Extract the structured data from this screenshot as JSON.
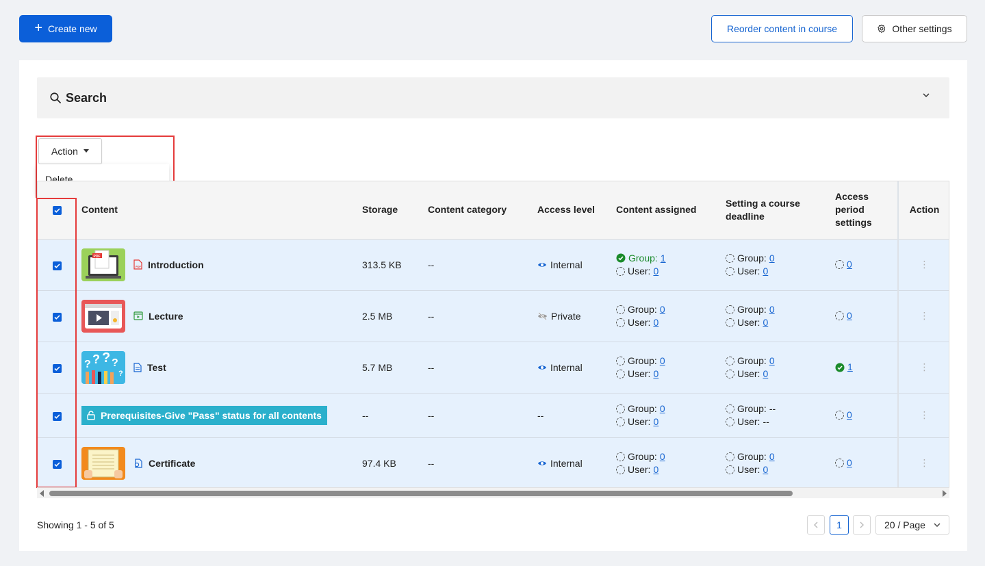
{
  "toolbar": {
    "create_label": "Create new",
    "reorder_label": "Reorder content in course",
    "settings_label": "Other settings"
  },
  "search": {
    "title": "Search"
  },
  "bulk_action": {
    "label": "Action",
    "menu_item": "Delete"
  },
  "table": {
    "headers": {
      "content": "Content",
      "storage": "Storage",
      "category": "Content category",
      "access": "Access level",
      "assigned": "Content assigned",
      "deadline": "Setting a course deadline",
      "period": "Access period settings",
      "action": "Action"
    },
    "group_label": "Group:",
    "user_label": "User:",
    "rows": [
      {
        "title": "Introduction",
        "storage": "313.5 KB",
        "category": "--",
        "access": "Internal",
        "assigned_group": "1",
        "assigned_user": "0",
        "deadline_group": "0",
        "deadline_user": "0",
        "period": "0"
      },
      {
        "title": "Lecture",
        "storage": "2.5 MB",
        "category": "--",
        "access": "Private",
        "assigned_group": "0",
        "assigned_user": "0",
        "deadline_group": "0",
        "deadline_user": "0",
        "period": "0"
      },
      {
        "title": "Test",
        "storage": "5.7 MB",
        "category": "--",
        "access": "Internal",
        "assigned_group": "0",
        "assigned_user": "0",
        "deadline_group": "0",
        "deadline_user": "0",
        "period": "1"
      },
      {
        "title": "Prerequisites-Give \"Pass\" status for all contents",
        "storage": "--",
        "category": "--",
        "access": "--",
        "assigned_group": "0",
        "assigned_user": "0",
        "deadline_group": "--",
        "deadline_user": "--",
        "period": "0"
      },
      {
        "title": "Certificate",
        "storage": "97.4 KB",
        "category": "--",
        "access": "Internal",
        "assigned_group": "0",
        "assigned_user": "0",
        "deadline_group": "0",
        "deadline_user": "0",
        "period": "0"
      }
    ]
  },
  "footer": {
    "showing": "Showing 1 - 5 of 5",
    "current_page": "1",
    "page_size": "20 / Page"
  },
  "colors": {
    "primary": "#0b5fd9",
    "row_selected": "#e6f1fd",
    "highlight_border": "#e53b3b",
    "prereq_bg": "#2bb0cc",
    "check_green": "#1a8a2a"
  }
}
